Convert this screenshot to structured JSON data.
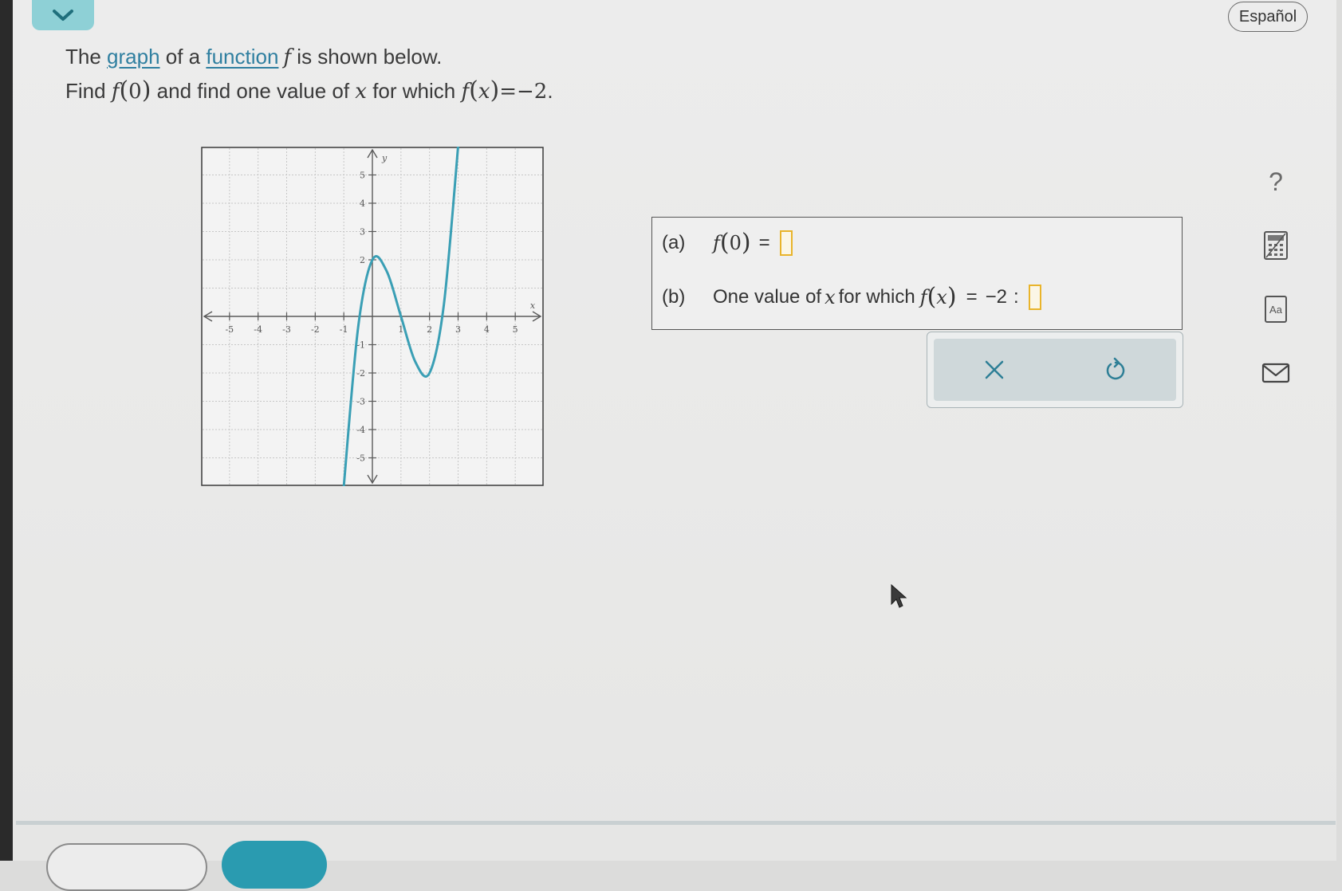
{
  "header": {
    "language_button": "Español"
  },
  "question": {
    "line1": {
      "t1": "The ",
      "graph_link": "graph",
      "t2": " of a ",
      "function_link": "function",
      "var_f": "f",
      "t3": " is shown below."
    },
    "line2": {
      "t1": "Find ",
      "f": "f",
      "open": "(",
      "zero": "0",
      "close": ")",
      "t2": " and find one value of ",
      "x": "x",
      "t3": " for which ",
      "f2": "f",
      "open2": "(",
      "x2": "x",
      "close2": ")",
      "eq": "=−2",
      "period": "."
    }
  },
  "chart_data": {
    "type": "line",
    "xlabel": "x",
    "ylabel": "y",
    "xlim": [
      -6,
      6
    ],
    "ylim": [
      -6,
      6
    ],
    "x_ticks": [
      "-5",
      "-4",
      "-3",
      "-2",
      "-1",
      "1",
      "2",
      "3",
      "4",
      "5"
    ],
    "y_ticks": [
      "5",
      "4",
      "3",
      "2",
      "-1",
      "-2",
      "-3",
      "-4",
      "-5"
    ],
    "grid": true,
    "series": [
      {
        "points": [
          [
            -1.0,
            -6.0
          ],
          [
            -0.5,
            -0.4
          ],
          [
            0.0,
            2.0
          ],
          [
            0.5,
            1.6
          ],
          [
            1.0,
            0.0
          ],
          [
            1.5,
            -1.6
          ],
          [
            2.0,
            -2.0
          ],
          [
            2.5,
            0.4
          ],
          [
            3.0,
            6.0
          ]
        ]
      }
    ],
    "colors": {
      "curve": "#3a9fb5",
      "grid": "#c7c7c7",
      "axis": "#5a5a5a"
    }
  },
  "answers": {
    "a": {
      "tag": "(a)",
      "f": "f",
      "open": "(",
      "zero": "0",
      "close": ")",
      "eq": "=",
      "value": ""
    },
    "b": {
      "tag": "(b)",
      "text1": "One value of ",
      "x": "x",
      "text2": " for which ",
      "f": "f",
      "open": "(",
      "x2": "x",
      "close": ")",
      "eq": "=",
      "rhs": "−2",
      "colon": ":",
      "value": ""
    }
  },
  "actions": {
    "clear_icon": "close-icon",
    "undo_icon": "undo-icon"
  },
  "sidebar_tools": {
    "help": "?",
    "icons": [
      "help-icon",
      "calculator-icon",
      "text-size-icon",
      "mail-icon"
    ],
    "text_size_label": "Aa"
  },
  "colors": {
    "accent": "#3a9fb5",
    "collapse_bg": "#8ed0d6",
    "input_border": "#e9b42b"
  }
}
